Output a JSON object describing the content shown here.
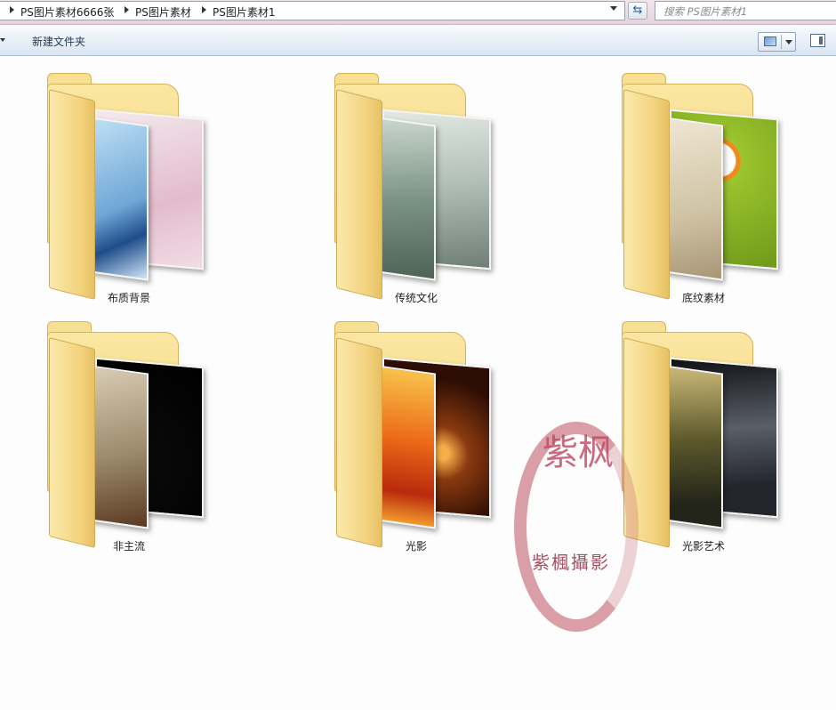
{
  "address": {
    "crumbs": [
      "PS图片素材6666张",
      "PS图片素材",
      "PS图片素材1"
    ]
  },
  "search": {
    "placeholder": "搜索 PS图片素材1"
  },
  "toolbar": {
    "new_folder": "新建文件夹"
  },
  "folders": [
    {
      "name": "布质背景",
      "colors": [
        "#9cc6e6",
        "#e9c8d6"
      ]
    },
    {
      "name": "传统文化",
      "colors": [
        "#9fb3a6",
        "#c9d3cc"
      ]
    },
    {
      "name": "底纹素材",
      "colors": [
        "#d8cdb5",
        "#a8c83a"
      ]
    },
    {
      "name": "非主流",
      "colors": [
        "#b7a589",
        "#111111"
      ]
    },
    {
      "name": "光影",
      "colors": [
        "#e6551c",
        "#5a2608"
      ]
    },
    {
      "name": "光影艺术",
      "colors": [
        "#6b6a3a",
        "#3b3f4a"
      ]
    }
  ],
  "watermark": {
    "title": "紫枫",
    "subtitle": "紫楓攝影"
  }
}
